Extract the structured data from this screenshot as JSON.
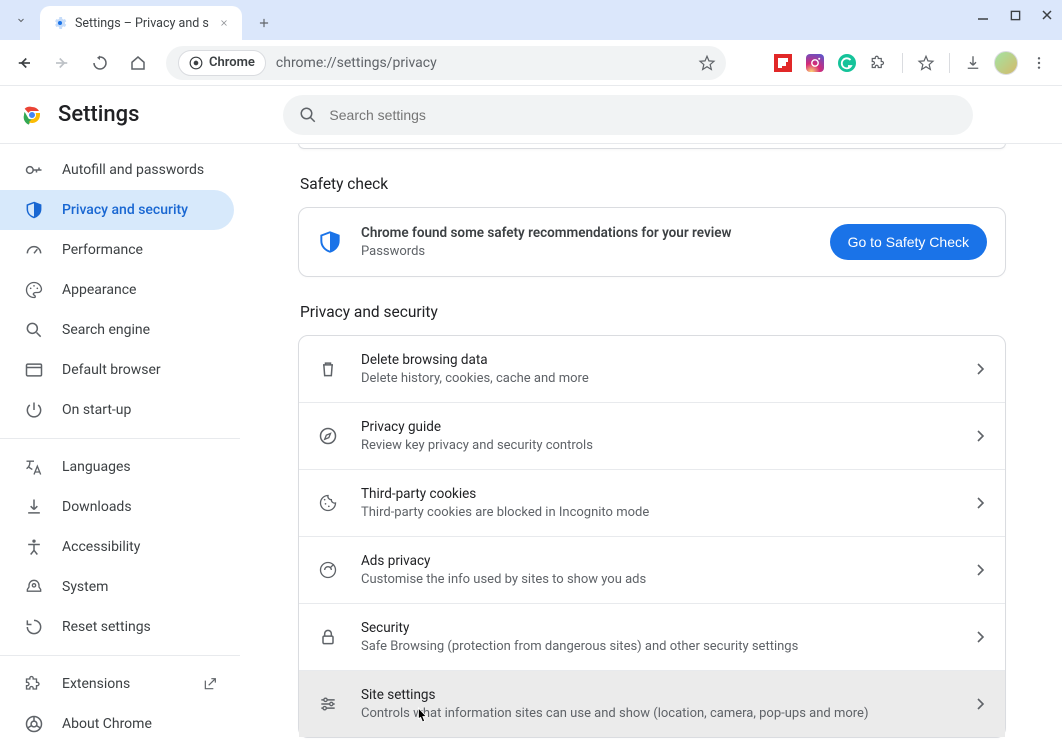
{
  "window": {
    "tab_title": "Settings – Privacy and s",
    "url": "chrome://settings/privacy",
    "chrome_chip": "Chrome"
  },
  "header": {
    "title": "Settings",
    "search_placeholder": "Search settings"
  },
  "sidebar": {
    "items": [
      {
        "label": "Autofill and passwords",
        "icon": "key"
      },
      {
        "label": "Privacy and security",
        "icon": "shield",
        "selected": true
      },
      {
        "label": "Performance",
        "icon": "gauge"
      },
      {
        "label": "Appearance",
        "icon": "palette"
      },
      {
        "label": "Search engine",
        "icon": "search"
      },
      {
        "label": "Default browser",
        "icon": "browser"
      },
      {
        "label": "On start-up",
        "icon": "power"
      }
    ],
    "items2": [
      {
        "label": "Languages",
        "icon": "translate"
      },
      {
        "label": "Downloads",
        "icon": "download"
      },
      {
        "label": "Accessibility",
        "icon": "accessibility"
      },
      {
        "label": "System",
        "icon": "system"
      },
      {
        "label": "Reset settings",
        "icon": "reset"
      }
    ],
    "items3": [
      {
        "label": "Extensions",
        "icon": "extension",
        "external": true
      },
      {
        "label": "About Chrome",
        "icon": "chrome"
      }
    ]
  },
  "content": {
    "safety_section_title": "Safety check",
    "safety_card": {
      "title": "Chrome found some safety recommendations for your review",
      "subtitle": "Passwords",
      "button": "Go to Safety Check"
    },
    "privacy_section_title": "Privacy and security",
    "rows": [
      {
        "title": "Delete browsing data",
        "sub": "Delete history, cookies, cache and more",
        "icon": "trash"
      },
      {
        "title": "Privacy guide",
        "sub": "Review key privacy and security controls",
        "icon": "compass"
      },
      {
        "title": "Third-party cookies",
        "sub": "Third-party cookies are blocked in Incognito mode",
        "icon": "cookie"
      },
      {
        "title": "Ads privacy",
        "sub": "Customise the info used by sites to show you ads",
        "icon": "ads"
      },
      {
        "title": "Security",
        "sub": "Safe Browsing (protection from dangerous sites) and other security settings",
        "icon": "lock"
      },
      {
        "title": "Site settings",
        "sub": "Controls what information sites can use and show (location, camera, pop-ups and more)",
        "icon": "tune",
        "hover": true
      }
    ]
  }
}
